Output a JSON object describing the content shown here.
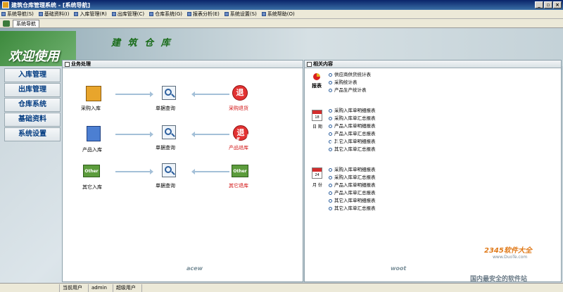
{
  "window": {
    "title": "建筑仓库管理系统 - [系统导航]",
    "buttons": {
      "minimize": "_",
      "restore": "▫",
      "close": "×"
    }
  },
  "menu": [
    "系统导航(S)",
    "基础资料(I)",
    "入库管理(R)",
    "出库管理(C)",
    "仓库系统(G)",
    "报表分析(E)",
    "系统设置(S)",
    "系统帮助(O)"
  ],
  "tab": {
    "label": "系统导航"
  },
  "banner": {
    "welcome": "欢迎使用",
    "title": "建 筑 仓 库"
  },
  "sidenav": [
    "入库管理",
    "出库管理",
    "仓库系统",
    "基础资料",
    "系统设置"
  ],
  "left_panel": {
    "title": "业务处理",
    "rows": [
      {
        "source": "采购入库",
        "middle": "单据查询",
        "target": "采购退货"
      },
      {
        "source": "产品入库",
        "middle": "单据查询",
        "target": "产品退库"
      },
      {
        "source": "其它入库",
        "middle": "单据查询",
        "target": "其它退库"
      }
    ],
    "other_badge": "Other",
    "return_char": "退"
  },
  "right_panel": {
    "title": "相关内容",
    "groups": [
      {
        "label": "报表",
        "icon": "pie-chart-icon",
        "items": [
          "供应商供货统计表",
          "采购统计表",
          "产品生产统计表"
        ]
      },
      {
        "label": "日 期",
        "icon": "calendar-icon",
        "badge": "18",
        "items": [
          "采购入库单明细报表",
          "采购入库单汇总报表",
          "产品入库单明细报表",
          "产品入库单汇总报表",
          "其它入库单明细报表",
          "其它入库单汇总报表"
        ]
      },
      {
        "label": "月 份",
        "icon": "calendar-icon",
        "badge": "24",
        "items": [
          "采购入库单明细报表",
          "采购入库单汇总报表",
          "产品入库单明细报表",
          "产品入库单汇总报表",
          "其它入库单明细报表",
          "其它入库单汇总报表"
        ]
      }
    ]
  },
  "watermarks": {
    "main": "www.DuoTe.com",
    "logo": "2345软件大全",
    "small": "www.DuoTe.com",
    "footer": "国内最安全的软件站"
  },
  "deco": {
    "left": "acew",
    "right": "woot"
  },
  "status": {
    "user_label": "当前用户",
    "user": "admin",
    "role": "超级用户"
  }
}
